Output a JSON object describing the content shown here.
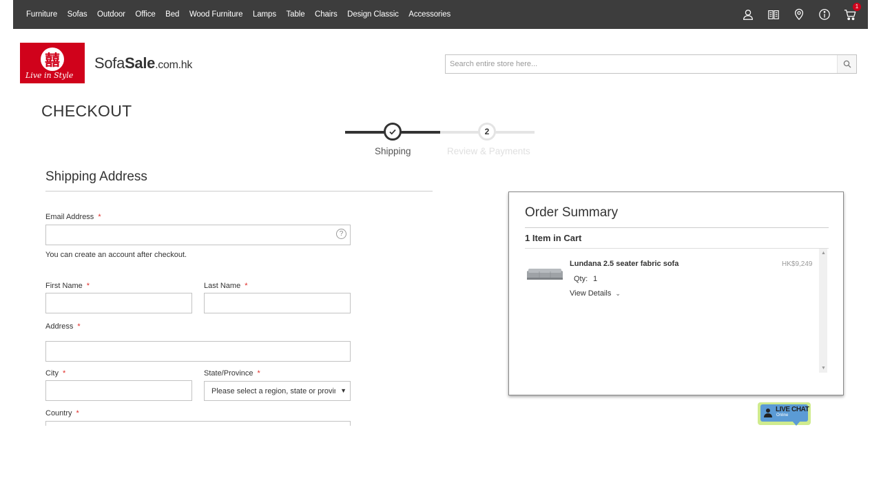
{
  "nav": {
    "items": [
      "Furniture",
      "Sofas",
      "Outdoor",
      "Office",
      "Bed",
      "Wood Furniture",
      "Lamps",
      "Table",
      "Chairs",
      "Design Classic",
      "Accessories"
    ],
    "icons": [
      "account-icon",
      "catalog-icon",
      "location-icon",
      "info-icon",
      "cart-icon"
    ],
    "cart_count": "1",
    "bg_color": "#3d3d3d"
  },
  "header": {
    "logo_tagline": "Live in Style",
    "logo_glyph": "囍",
    "site_name_a": "Sofa",
    "site_name_b": "Sale",
    "site_name_c": ".com.hk",
    "search_placeholder": "Search entire store here...",
    "brand_color": "#d0021b"
  },
  "checkout": {
    "title": "CHECKOUT",
    "steps": [
      {
        "label": "Shipping",
        "state": "complete"
      },
      {
        "number": "2",
        "label": "Review & Payments",
        "state": "pending"
      }
    ]
  },
  "shipping": {
    "title": "Shipping Address",
    "email_label": "Email Address",
    "email_note": "You can create an account after checkout.",
    "first_name_label": "First Name",
    "last_name_label": "Last Name",
    "address_label": "Address",
    "city_label": "City",
    "state_label": "State/Province",
    "state_placeholder": "Please select a region, state or province.",
    "country_label": "Country",
    "required_mark": "*"
  },
  "summary": {
    "title": "Order Summary",
    "count_text": "1 Item in Cart",
    "item": {
      "name": "Lundana 2.5 seater fabric sofa",
      "price": "HK$9,249",
      "qty_label": "Qty:",
      "qty": "1",
      "details_label": "View Details"
    }
  },
  "livechat": {
    "label": "LIVE CHAT",
    "status": "Online"
  }
}
